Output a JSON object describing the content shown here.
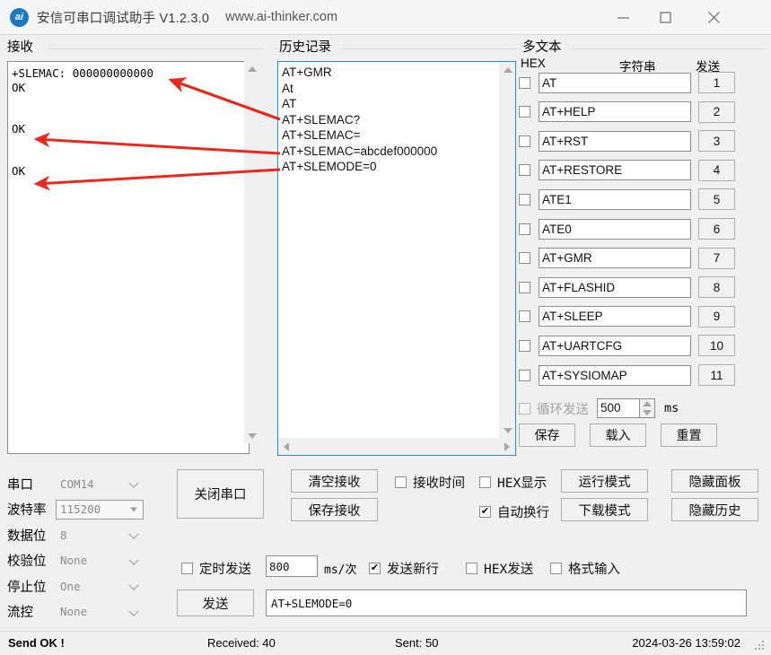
{
  "window": {
    "title": "安信可串口调试助手 V1.2.3.0",
    "url": "www.ai-thinker.com",
    "icon_text": "ai",
    "minimize": "—",
    "maximize": "□",
    "close": "✕"
  },
  "receive": {
    "label": "接收",
    "content": "+SLEMAC: 000000000000\nOK\n\n\nOK\n\n\nOK"
  },
  "history": {
    "label": "历史记录",
    "content": "AT+GMR\nAt\nAT\nAT+SLEMAC?\nAT+SLEMAC=\nAT+SLEMAC=abcdef000000\nAT+SLEMODE=0"
  },
  "multitext": {
    "label": "多文本",
    "col_hex": "HEX",
    "col_string": "字符串",
    "col_send": "发送",
    "rows": [
      {
        "hex_checked": false,
        "text": "AT",
        "send": "1"
      },
      {
        "hex_checked": false,
        "text": "AT+HELP",
        "send": "2"
      },
      {
        "hex_checked": false,
        "text": "AT+RST",
        "send": "3"
      },
      {
        "hex_checked": false,
        "text": "AT+RESTORE",
        "send": "4"
      },
      {
        "hex_checked": false,
        "text": "ATE1",
        "send": "5"
      },
      {
        "hex_checked": false,
        "text": "ATE0",
        "send": "6"
      },
      {
        "hex_checked": false,
        "text": "AT+GMR",
        "send": "7"
      },
      {
        "hex_checked": false,
        "text": "AT+FLASHID",
        "send": "8"
      },
      {
        "hex_checked": false,
        "text": "AT+SLEEP",
        "send": "9"
      },
      {
        "hex_checked": false,
        "text": "AT+UARTCFG",
        "send": "10"
      },
      {
        "hex_checked": false,
        "text": "AT+SYSIOMAP",
        "send": "11"
      }
    ],
    "loop_label": "循环发送",
    "loop_checked": false,
    "loop_value": "500",
    "loop_unit": "ms",
    "btn_save": "保存",
    "btn_load": "载入",
    "btn_reset": "重置"
  },
  "serial": {
    "rows": [
      {
        "label": "串口",
        "value": "COM14"
      },
      {
        "label": "波特率",
        "value": "115200"
      },
      {
        "label": "数据位",
        "value": "8"
      },
      {
        "label": "校验位",
        "value": "None"
      },
      {
        "label": "停止位",
        "value": "One"
      },
      {
        "label": "流控",
        "value": "None"
      }
    ]
  },
  "controls": {
    "close_port": "关闭串口",
    "clear_recv": "清空接收",
    "save_recv": "保存接收",
    "chk_recv_time": {
      "label": "接收时间",
      "checked": false
    },
    "chk_hex_display": {
      "label": "HEX显示",
      "checked": false
    },
    "chk_auto_newline": {
      "label": "自动换行",
      "checked": true
    },
    "btn_run_mode": "运行模式",
    "btn_download_mode": "下载模式",
    "btn_hide_panel": "隐藏面板",
    "btn_hide_history": "隐藏历史"
  },
  "send": {
    "chk_timed": {
      "label": "定时发送",
      "checked": false
    },
    "interval": "800",
    "interval_unit": "ms/次",
    "chk_newline": {
      "label": "发送新行",
      "checked": true
    },
    "chk_hex_send": {
      "label": "HEX发送",
      "checked": false
    },
    "chk_format_input": {
      "label": "格式输入",
      "checked": false
    },
    "btn_send": "发送",
    "input_value": "AT+SLEMODE=0"
  },
  "status": {
    "message": "Send OK !",
    "received": "Received: 40",
    "sent": "Sent: 50",
    "datetime": "2024-03-26 13:59:02"
  },
  "annotations": {
    "arrow_color": "#e8291c",
    "count": 3
  }
}
